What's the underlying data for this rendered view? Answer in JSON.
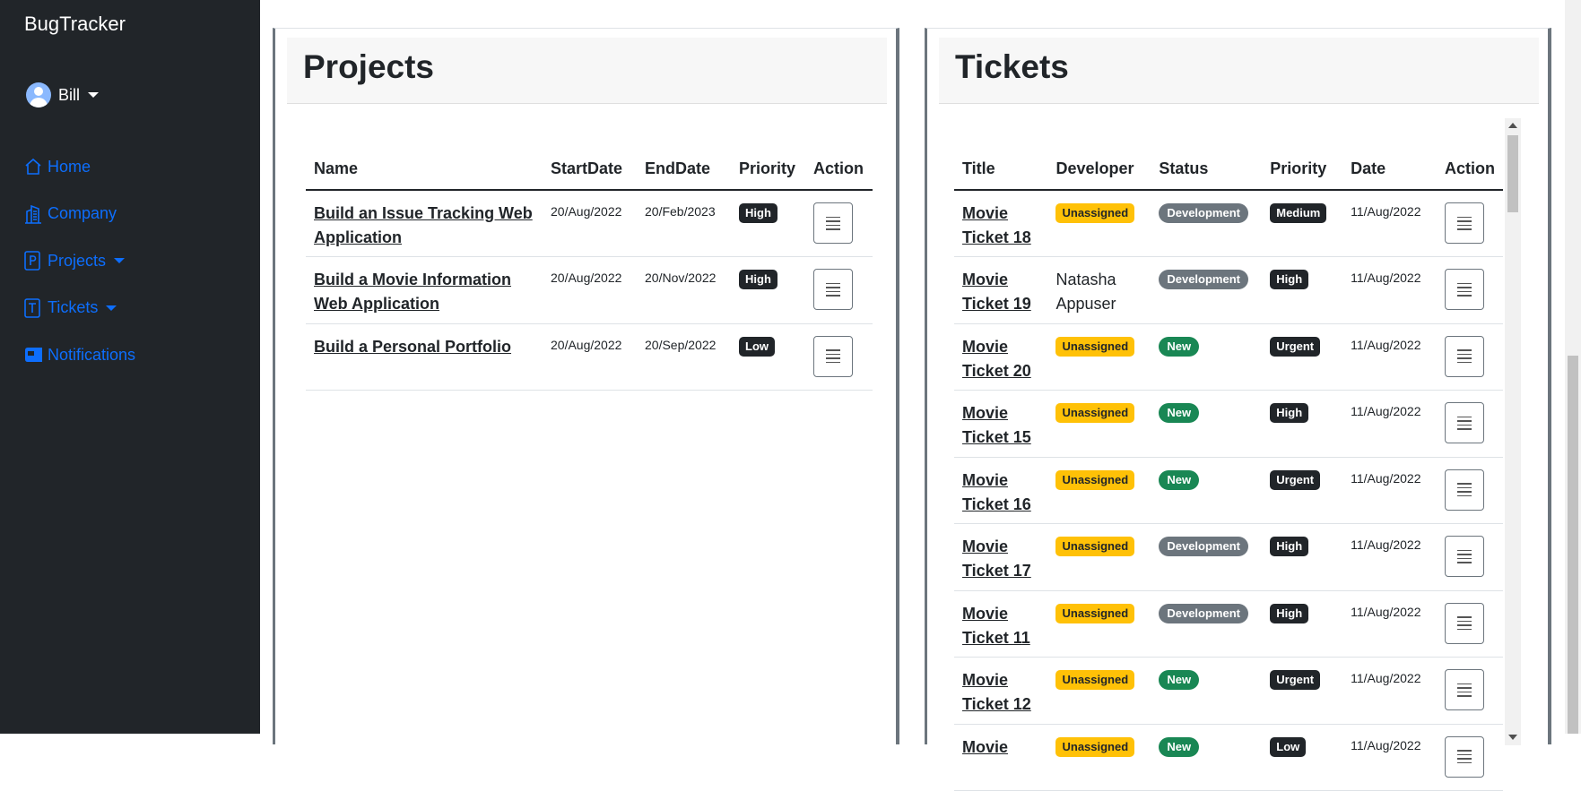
{
  "app": {
    "title": "BugTracker"
  },
  "user": {
    "name": "Bill"
  },
  "nav": [
    {
      "label": "Home",
      "icon": "home-icon"
    },
    {
      "label": "Company",
      "icon": "building-icon"
    },
    {
      "label": "Projects",
      "icon": "file-p-icon",
      "dropdown": true
    },
    {
      "label": "Tickets",
      "icon": "file-t-icon",
      "dropdown": true
    },
    {
      "label": "Notifications",
      "icon": "notification-icon"
    }
  ],
  "projects": {
    "title": "Projects",
    "columns": [
      "Name",
      "StartDate",
      "EndDate",
      "Priority",
      "Action"
    ],
    "rows": [
      {
        "name": "Build an Issue Tracking Web Application",
        "start": "20/Aug/2022",
        "end": "20/Feb/2023",
        "priority": "High"
      },
      {
        "name": "Build a Movie Information Web Application",
        "start": "20/Aug/2022",
        "end": "20/Nov/2022",
        "priority": "High"
      },
      {
        "name": "Build a Personal Portfolio",
        "start": "20/Aug/2022",
        "end": "20/Sep/2022",
        "priority": "Low"
      }
    ]
  },
  "tickets": {
    "title": "Tickets",
    "columns": [
      "Title",
      "Developer",
      "Status",
      "Priority",
      "Date",
      "Action"
    ],
    "rows": [
      {
        "title": "Movie Ticket 18",
        "developer": "Unassigned",
        "status": "Development",
        "priority": "Medium",
        "date": "11/Aug/2022"
      },
      {
        "title": "Movie Ticket 19",
        "developer": "Natasha Appuser",
        "status": "Development",
        "priority": "High",
        "date": "11/Aug/2022"
      },
      {
        "title": "Movie Ticket 20",
        "developer": "Unassigned",
        "status": "New",
        "priority": "Urgent",
        "date": "11/Aug/2022"
      },
      {
        "title": "Movie Ticket 15",
        "developer": "Unassigned",
        "status": "New",
        "priority": "High",
        "date": "11/Aug/2022"
      },
      {
        "title": "Movie Ticket 16",
        "developer": "Unassigned",
        "status": "New",
        "priority": "Urgent",
        "date": "11/Aug/2022"
      },
      {
        "title": "Movie Ticket 17",
        "developer": "Unassigned",
        "status": "Development",
        "priority": "High",
        "date": "11/Aug/2022"
      },
      {
        "title": "Movie Ticket 11",
        "developer": "Unassigned",
        "status": "Development",
        "priority": "High",
        "date": "11/Aug/2022"
      },
      {
        "title": "Movie Ticket 12",
        "developer": "Unassigned",
        "status": "New",
        "priority": "Urgent",
        "date": "11/Aug/2022"
      },
      {
        "title": "Movie",
        "developer": "Unassigned",
        "status": "New",
        "priority": "Low",
        "date": "11/Aug/2022"
      }
    ]
  },
  "colors": {
    "sidebar_bg": "#212529",
    "link_blue": "#0d6efd",
    "badge_warning": "#ffc107",
    "badge_secondary": "#6c757d",
    "badge_success": "#198754",
    "badge_dark": "#212529"
  }
}
